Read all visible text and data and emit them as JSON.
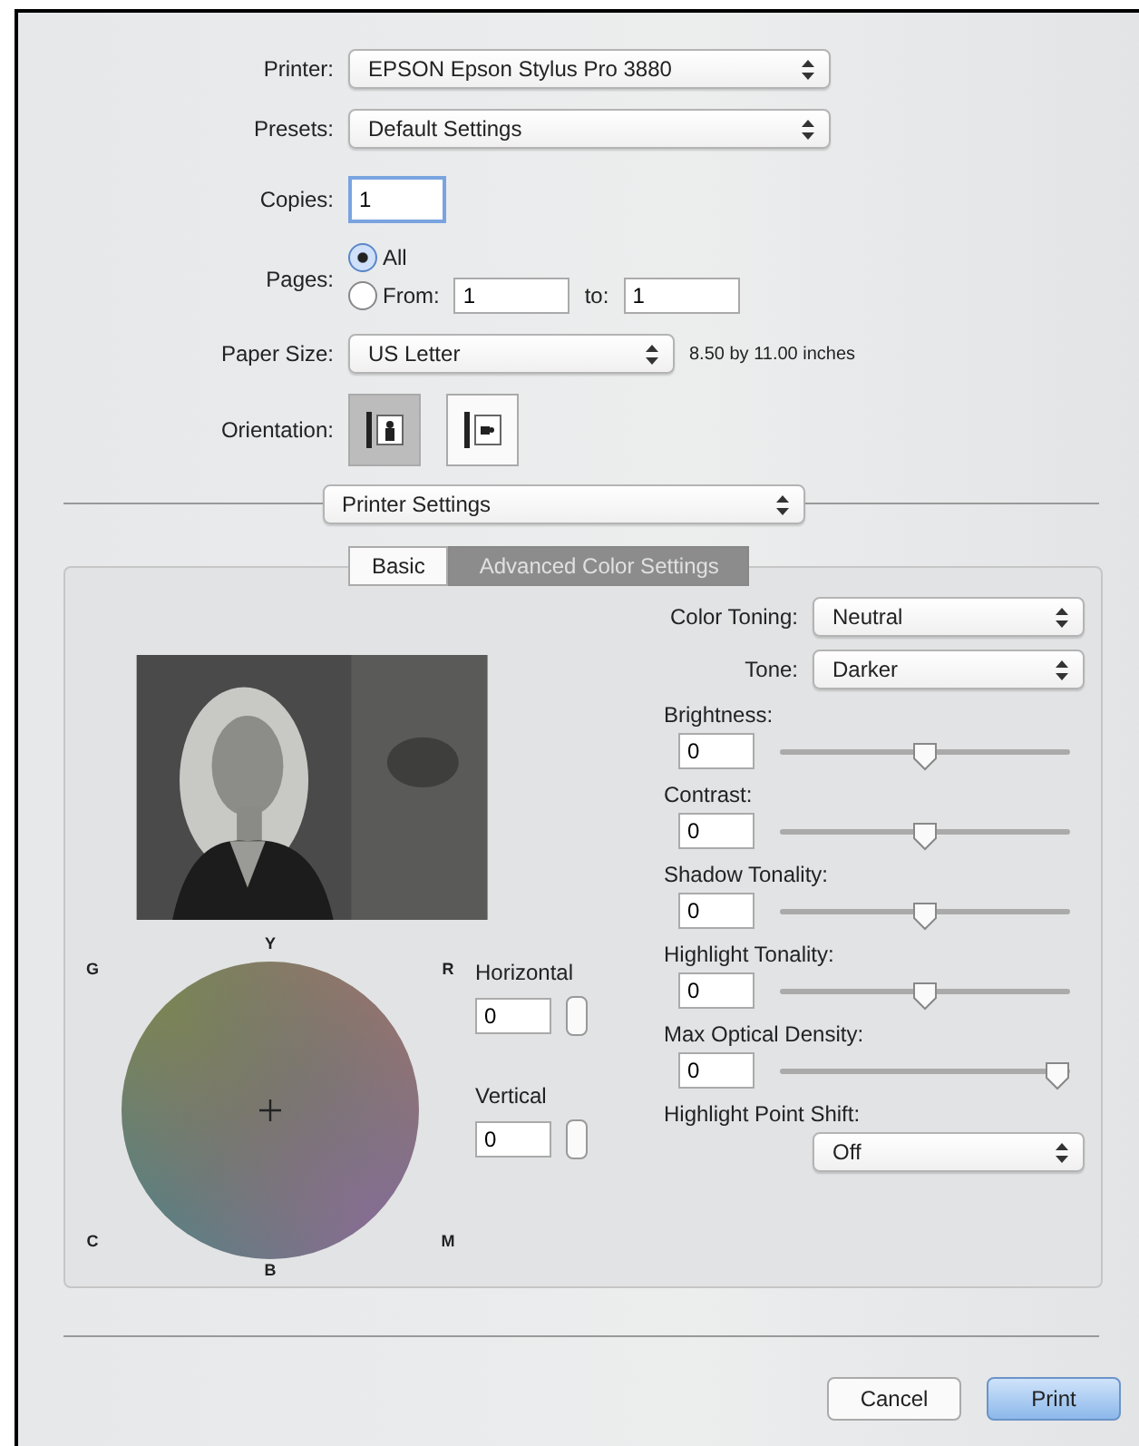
{
  "printer": {
    "label": "Printer:",
    "value": "EPSON Epson Stylus Pro 3880"
  },
  "presets": {
    "label": "Presets:",
    "value": "Default Settings"
  },
  "copies": {
    "label": "Copies:",
    "value": "1"
  },
  "pages": {
    "label": "Pages:",
    "options": [
      {
        "label": "All",
        "selected": true
      },
      {
        "label": "From:",
        "selected": false
      }
    ],
    "from": "1",
    "to_label": "to:",
    "to": "1"
  },
  "paper_size": {
    "label": "Paper Size:",
    "value": "US Letter",
    "note": "8.50 by 11.00 inches"
  },
  "orientation": {
    "label": "Orientation:",
    "options": [
      {
        "kind": "portrait",
        "selected": true
      },
      {
        "kind": "landscape",
        "selected": false
      }
    ]
  },
  "panel_menu": {
    "value": "Printer Settings"
  },
  "tabs": [
    {
      "label": "Basic",
      "selected": false
    },
    {
      "label": "Advanced Color Settings",
      "selected": true
    }
  ],
  "color_wheel": {
    "labels": {
      "top": "Y",
      "left_top": "G",
      "right_top": "R",
      "left_bottom": "C",
      "right_bottom": "M",
      "bottom": "B"
    }
  },
  "horizontal": {
    "label": "Horizontal",
    "value": "0"
  },
  "vertical": {
    "label": "Vertical",
    "value": "0"
  },
  "color_toning": {
    "label": "Color Toning:",
    "value": "Neutral"
  },
  "tone": {
    "label": "Tone:",
    "value": "Darker"
  },
  "sliders": [
    {
      "label": "Brightness:",
      "value": "0",
      "level": 0.5
    },
    {
      "label": "Contrast:",
      "value": "0",
      "level": 0.5
    },
    {
      "label": "Shadow Tonality:",
      "value": "0",
      "level": 0.5
    },
    {
      "label": "Highlight Tonality:",
      "value": "0",
      "level": 0.5
    },
    {
      "label": "Max Optical Density:",
      "value": "0",
      "level": 1
    }
  ],
  "highlight_point_shift": {
    "label": "Highlight Point Shift:",
    "value": "Off"
  },
  "buttons": [
    {
      "label": "Cancel",
      "kind": "secondary"
    },
    {
      "label": "Print",
      "kind": "default"
    }
  ]
}
